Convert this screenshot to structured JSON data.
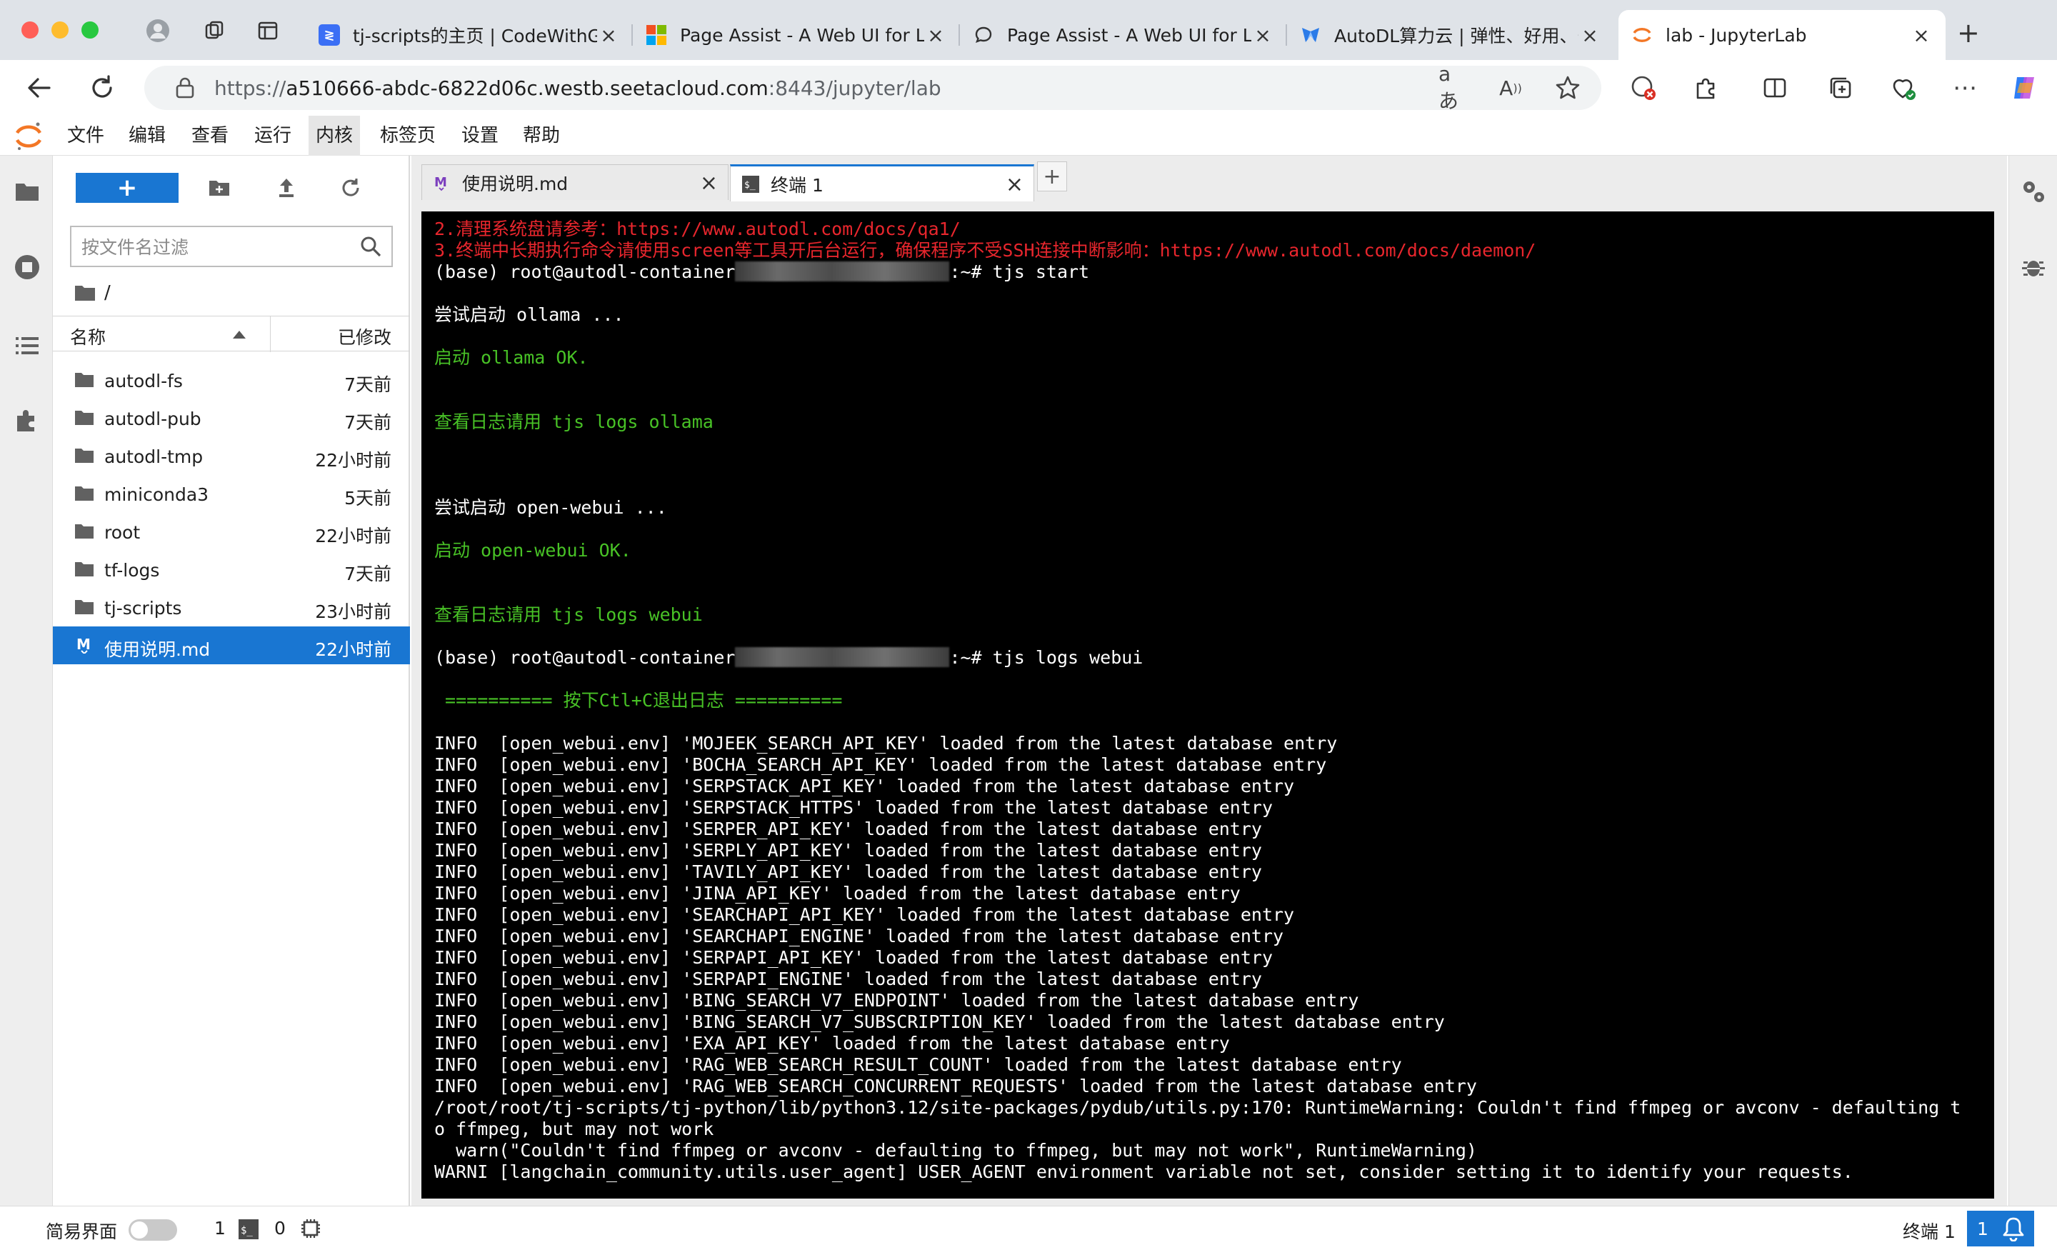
{
  "browser": {
    "tabs": [
      {
        "title": "tj-scripts的主页 | CodeWithGPU",
        "favicon": "codewithgpu-icon"
      },
      {
        "title": "Page Assist - A Web UI for Local AI Models",
        "favicon": "microsoft-store-icon"
      },
      {
        "title": "Page Assist - A Web UI for Local AI Models",
        "favicon": "chat-bubble-icon"
      },
      {
        "title": "AutoDL算力云 | 弹性、好用、省钱",
        "favicon": "autodl-icon"
      },
      {
        "title": "lab - JupyterLab",
        "favicon": "jupyter-icon",
        "active": true
      }
    ],
    "url_prefix": "https://",
    "url_host": "a510666-abdc-6822d06c.westb.seetacloud.com",
    "url_rest": ":8443/jupyter/lab",
    "translate_icon": "aあ",
    "read_aloud_icon": "A"
  },
  "jupyter": {
    "menu": [
      "文件",
      "编辑",
      "查看",
      "运行",
      "内核",
      "标签页",
      "设置",
      "帮助"
    ],
    "active_menu": "内核",
    "filebrowser": {
      "new_label": "+",
      "filter_placeholder": "按文件名过滤",
      "breadcrumb": "/",
      "col_name": "名称",
      "col_modified": "已修改",
      "files": [
        {
          "name": "autodl-fs",
          "modified": "7天前",
          "type": "folder"
        },
        {
          "name": "autodl-pub",
          "modified": "7天前",
          "type": "folder"
        },
        {
          "name": "autodl-tmp",
          "modified": "22小时前",
          "type": "folder"
        },
        {
          "name": "miniconda3",
          "modified": "5天前",
          "type": "folder"
        },
        {
          "name": "root",
          "modified": "22小时前",
          "type": "folder"
        },
        {
          "name": "tf-logs",
          "modified": "7天前",
          "type": "folder"
        },
        {
          "name": "tj-scripts",
          "modified": "23小时前",
          "type": "folder"
        },
        {
          "name": "使用说明.md",
          "modified": "22小时前",
          "type": "markdown",
          "selected": true
        }
      ]
    },
    "doc_tabs": [
      {
        "label": "使用说明.md",
        "icon": "markdown-icon"
      },
      {
        "label": "终端 1",
        "icon": "terminal-icon",
        "active": true
      }
    ],
    "add_tab_label": "+",
    "terminal": {
      "lines": [
        {
          "text": "2.清理系统盘请参考：https://www.autodl.com/docs/qa1/",
          "color": "red"
        },
        {
          "text": "3.终端中长期执行命令请使用screen等工具开后台运行，确保程序不受SSH连接中断影响：https://www.autodl.com/docs/daemon/",
          "color": "red"
        },
        {
          "text": "(base) root@autodl-container",
          "color": "white",
          "blur": true,
          "after": ":~# tjs start"
        },
        {
          "text": "",
          "color": "white"
        },
        {
          "text": "尝试启动 ollama ...",
          "color": "white"
        },
        {
          "text": "",
          "color": "white"
        },
        {
          "text": "启动 ollama OK.",
          "color": "green"
        },
        {
          "text": "",
          "color": "white"
        },
        {
          "text": "",
          "color": "white"
        },
        {
          "text": "查看日志请用 tjs logs ollama",
          "color": "green"
        },
        {
          "text": "",
          "color": "white"
        },
        {
          "text": "",
          "color": "white"
        },
        {
          "text": "",
          "color": "white"
        },
        {
          "text": "尝试启动 open-webui ...",
          "color": "white"
        },
        {
          "text": "",
          "color": "white"
        },
        {
          "text": "启动 open-webui OK.",
          "color": "green"
        },
        {
          "text": "",
          "color": "white"
        },
        {
          "text": "",
          "color": "white"
        },
        {
          "text": "查看日志请用 tjs logs webui",
          "color": "green"
        },
        {
          "text": "",
          "color": "white"
        },
        {
          "text": "(base) root@autodl-container",
          "color": "white",
          "blur": true,
          "after": ":~# tjs logs webui"
        },
        {
          "text": "",
          "color": "white"
        },
        {
          "text": " ========== 按下Ctl+C退出日志 ==========",
          "color": "green"
        },
        {
          "text": "",
          "color": "white"
        },
        {
          "text": "INFO  [open_webui.env] 'MOJEEK_SEARCH_API_KEY' loaded from the latest database entry",
          "color": "white"
        },
        {
          "text": "INFO  [open_webui.env] 'BOCHA_SEARCH_API_KEY' loaded from the latest database entry",
          "color": "white"
        },
        {
          "text": "INFO  [open_webui.env] 'SERPSTACK_API_KEY' loaded from the latest database entry",
          "color": "white"
        },
        {
          "text": "INFO  [open_webui.env] 'SERPSTACK_HTTPS' loaded from the latest database entry",
          "color": "white"
        },
        {
          "text": "INFO  [open_webui.env] 'SERPER_API_KEY' loaded from the latest database entry",
          "color": "white"
        },
        {
          "text": "INFO  [open_webui.env] 'SERPLY_API_KEY' loaded from the latest database entry",
          "color": "white"
        },
        {
          "text": "INFO  [open_webui.env] 'TAVILY_API_KEY' loaded from the latest database entry",
          "color": "white"
        },
        {
          "text": "INFO  [open_webui.env] 'JINA_API_KEY' loaded from the latest database entry",
          "color": "white"
        },
        {
          "text": "INFO  [open_webui.env] 'SEARCHAPI_API_KEY' loaded from the latest database entry",
          "color": "white"
        },
        {
          "text": "INFO  [open_webui.env] 'SEARCHAPI_ENGINE' loaded from the latest database entry",
          "color": "white"
        },
        {
          "text": "INFO  [open_webui.env] 'SERPAPI_API_KEY' loaded from the latest database entry",
          "color": "white"
        },
        {
          "text": "INFO  [open_webui.env] 'SERPAPI_ENGINE' loaded from the latest database entry",
          "color": "white"
        },
        {
          "text": "INFO  [open_webui.env] 'BING_SEARCH_V7_ENDPOINT' loaded from the latest database entry",
          "color": "white"
        },
        {
          "text": "INFO  [open_webui.env] 'BING_SEARCH_V7_SUBSCRIPTION_KEY' loaded from the latest database entry",
          "color": "white"
        },
        {
          "text": "INFO  [open_webui.env] 'EXA_API_KEY' loaded from the latest database entry",
          "color": "white"
        },
        {
          "text": "INFO  [open_webui.env] 'RAG_WEB_SEARCH_RESULT_COUNT' loaded from the latest database entry",
          "color": "white"
        },
        {
          "text": "INFO  [open_webui.env] 'RAG_WEB_SEARCH_CONCURRENT_REQUESTS' loaded from the latest database entry",
          "color": "white"
        },
        {
          "text": "/root/root/tj-scripts/tj-python/lib/python3.12/site-packages/pydub/utils.py:170: RuntimeWarning: Couldn't find ffmpeg or avconv - defaulting t",
          "color": "white"
        },
        {
          "text": "o ffmpeg, but may not work",
          "color": "white"
        },
        {
          "text": "  warn(\"Couldn't find ffmpeg or avconv - defaulting to ffmpeg, but may not work\", RuntimeWarning)",
          "color": "white"
        },
        {
          "text": "WARNI [langchain_community.utils.user_agent] USER_AGENT environment variable not set, consider setting it to identify your requests.",
          "color": "white"
        }
      ]
    },
    "statusbar": {
      "simple_mode": "简易界面",
      "kernels": "1",
      "terminals": "0",
      "current": "终端 1",
      "notifications": "1"
    }
  },
  "colors": {
    "accent": "#1976d2",
    "term_red": "#e8262d",
    "term_green": "#48c226"
  }
}
